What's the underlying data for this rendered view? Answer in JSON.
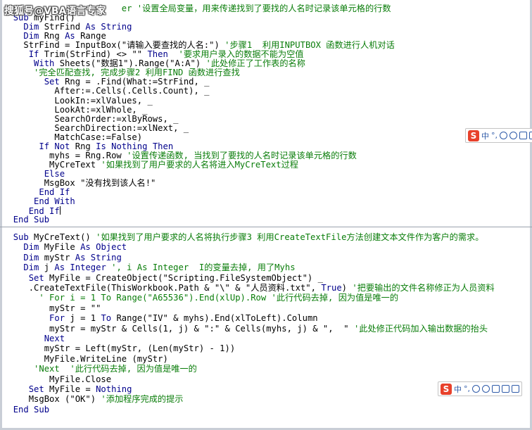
{
  "watermark": "搜狐号@VBA语言专家",
  "top_code": [
    {
      "indent": "   ",
      "parts": [
        {
          "t": "er '设置全局变量，用来传递找到了要找的人名时记录该单元格的行数",
          "c": "cm"
        }
      ],
      "lead": "Public myhs As Integ"
    },
    {
      "indent": "  ",
      "parts": [
        {
          "t": "Sub ",
          "c": "kw"
        },
        {
          "t": "myFind()",
          "c": ""
        }
      ]
    },
    {
      "indent": "    ",
      "parts": [
        {
          "t": "Dim ",
          "c": "kw"
        },
        {
          "t": "StrFind ",
          "c": ""
        },
        {
          "t": "As String",
          "c": "kw"
        }
      ]
    },
    {
      "indent": "    ",
      "parts": [
        {
          "t": "Dim ",
          "c": "kw"
        },
        {
          "t": "Rng ",
          "c": ""
        },
        {
          "t": "As ",
          "c": "kw"
        },
        {
          "t": "Range",
          "c": ""
        }
      ]
    },
    {
      "indent": "    ",
      "parts": [
        {
          "t": "StrFind = InputBox(\"请输入要查找的人名:\") ",
          "c": ""
        },
        {
          "t": "'步骤1  利用INPUTBOX 函数进行人机对话",
          "c": "cm"
        }
      ]
    },
    {
      "indent": "     ",
      "parts": [
        {
          "t": "If ",
          "c": "kw"
        },
        {
          "t": "Trim(StrFind) <> \"\" ",
          "c": ""
        },
        {
          "t": "Then  ",
          "c": "kw"
        },
        {
          "t": "'要求用户录入的数据不能为空值",
          "c": "cm"
        }
      ]
    },
    {
      "indent": "      ",
      "parts": [
        {
          "t": "With ",
          "c": "kw"
        },
        {
          "t": "Sheets(\"数据1\").Range(\"A:A\") ",
          "c": ""
        },
        {
          "t": "'此处修正了工作表的名称",
          "c": "cm"
        }
      ]
    },
    {
      "indent": "      ",
      "parts": [
        {
          "t": "'完全匹配查找, 完成步骤2 利用FIND 函数进行查找",
          "c": "cm"
        }
      ]
    },
    {
      "indent": "        ",
      "parts": [
        {
          "t": "Set ",
          "c": "kw"
        },
        {
          "t": "Rng = .Find(What:=StrFind, _",
          "c": ""
        }
      ]
    },
    {
      "indent": "          ",
      "parts": [
        {
          "t": "After:=.Cells(.Cells.Count), _",
          "c": ""
        }
      ]
    },
    {
      "indent": "          ",
      "parts": [
        {
          "t": "LookIn:=xlValues, _",
          "c": ""
        }
      ]
    },
    {
      "indent": "          ",
      "parts": [
        {
          "t": "LookAt:=xlWhole, _",
          "c": ""
        }
      ]
    },
    {
      "indent": "          ",
      "parts": [
        {
          "t": "SearchOrder:=xlByRows, _",
          "c": ""
        }
      ]
    },
    {
      "indent": "          ",
      "parts": [
        {
          "t": "SearchDirection:=xlNext, _",
          "c": ""
        }
      ]
    },
    {
      "indent": "          ",
      "parts": [
        {
          "t": "MatchCase:=False)",
          "c": ""
        }
      ]
    },
    {
      "indent": "       ",
      "parts": [
        {
          "t": "If Not ",
          "c": "kw"
        },
        {
          "t": "Rng ",
          "c": ""
        },
        {
          "t": "Is Nothing Then",
          "c": "kw"
        }
      ]
    },
    {
      "indent": "         ",
      "parts": [
        {
          "t": "myhs = Rng.Row ",
          "c": ""
        },
        {
          "t": "'设置传递函数, 当找到了要找的人名时记录该单元格的行数",
          "c": "cm"
        }
      ]
    },
    {
      "indent": "         ",
      "parts": [
        {
          "t": "MyCreText ",
          "c": ""
        },
        {
          "t": "'如果找到了用户要求的人名将进入MyCreText过程",
          "c": "cm"
        }
      ]
    },
    {
      "indent": "        ",
      "parts": [
        {
          "t": "Else",
          "c": "kw"
        }
      ]
    },
    {
      "indent": "        ",
      "parts": [
        {
          "t": "MsgBox \"没有找到该人名!\"",
          "c": ""
        }
      ]
    },
    {
      "indent": "       ",
      "parts": [
        {
          "t": "End If",
          "c": "kw"
        }
      ]
    },
    {
      "indent": "      ",
      "parts": [
        {
          "t": "End With",
          "c": "kw"
        }
      ]
    },
    {
      "indent": "     ",
      "parts": [
        {
          "t": "End If",
          "c": "kw"
        }
      ],
      "cursor": true
    },
    {
      "indent": "  ",
      "parts": [
        {
          "t": "End Sub",
          "c": "kw"
        }
      ]
    }
  ],
  "bottom_code": [
    {
      "indent": "  ",
      "parts": [
        {
          "t": "Sub ",
          "c": "kw"
        },
        {
          "t": "MyCreText() ",
          "c": ""
        },
        {
          "t": "'如果找到了用户要求的人名将执行步骤3 利用CreateTextFile方法创建文本文件作为客户的需求。",
          "c": "cm"
        }
      ]
    },
    {
      "indent": "    ",
      "parts": [
        {
          "t": "Dim ",
          "c": "kw"
        },
        {
          "t": "MyFile ",
          "c": ""
        },
        {
          "t": "As Object",
          "c": "kw"
        }
      ]
    },
    {
      "indent": "    ",
      "parts": [
        {
          "t": "Dim ",
          "c": "kw"
        },
        {
          "t": "myStr ",
          "c": ""
        },
        {
          "t": "As String",
          "c": "kw"
        }
      ]
    },
    {
      "indent": "    ",
      "parts": [
        {
          "t": "Dim ",
          "c": "kw"
        },
        {
          "t": "j ",
          "c": ""
        },
        {
          "t": "As Integer ",
          "c": "kw"
        },
        {
          "t": "', i As Integer  I的变量去掉, 用了Myhs",
          "c": "cm"
        }
      ]
    },
    {
      "indent": "     ",
      "parts": [
        {
          "t": "Set ",
          "c": "kw"
        },
        {
          "t": "MyFile = CreateObject(\"Scripting.FileSystemObject\") _",
          "c": ""
        }
      ]
    },
    {
      "indent": "     ",
      "parts": [
        {
          "t": ".CreateTextFile(ThisWorkbook.Path & \"\\\" & \"人员资料.txt\", ",
          "c": ""
        },
        {
          "t": "True",
          "c": "kw"
        },
        {
          "t": ") ",
          "c": ""
        },
        {
          "t": "'把要输出的文件名称修正为人员资料",
          "c": "cm"
        }
      ]
    },
    {
      "indent": "       ",
      "parts": [
        {
          "t": "' For i = 1 To Range(\"A65536\").End(xlUp).Row '此行代码去掉, 因为值是唯一的",
          "c": "cm"
        }
      ]
    },
    {
      "indent": "         ",
      "parts": [
        {
          "t": "myStr = \"\"",
          "c": ""
        }
      ]
    },
    {
      "indent": "         ",
      "parts": [
        {
          "t": "For ",
          "c": "kw"
        },
        {
          "t": "j = 1 ",
          "c": ""
        },
        {
          "t": "To ",
          "c": "kw"
        },
        {
          "t": "Range(\"IV\" & myhs).End(xlToLeft).Column",
          "c": ""
        }
      ]
    },
    {
      "indent": "         ",
      "parts": [
        {
          "t": "myStr = myStr & Cells(1, j) & \":\" & Cells(myhs, j) & \",  \" ",
          "c": ""
        },
        {
          "t": "'此处修正代码加入输出数据的抬头",
          "c": "cm"
        }
      ]
    },
    {
      "indent": "        ",
      "parts": [
        {
          "t": "Next",
          "c": "kw"
        }
      ]
    },
    {
      "indent": "        ",
      "parts": [
        {
          "t": "myStr = Left(myStr, (Len(myStr) - 1))",
          "c": ""
        }
      ]
    },
    {
      "indent": "        ",
      "parts": [
        {
          "t": "MyFile.WriteLine (myStr)",
          "c": ""
        }
      ]
    },
    {
      "indent": "      ",
      "parts": [
        {
          "t": "'Next  '此行代码去掉, 因为值是唯一的",
          "c": "cm"
        }
      ]
    },
    {
      "indent": "         ",
      "parts": [
        {
          "t": "MyFile.Close",
          "c": ""
        }
      ]
    },
    {
      "indent": "     ",
      "parts": [
        {
          "t": "Set ",
          "c": "kw"
        },
        {
          "t": "MyFile = ",
          "c": ""
        },
        {
          "t": "Nothing",
          "c": "kw"
        }
      ]
    },
    {
      "indent": "     ",
      "parts": [
        {
          "t": "MsgBox (\"OK\") ",
          "c": ""
        },
        {
          "t": "'添加程序完成的提示",
          "c": "cm"
        }
      ]
    },
    {
      "indent": "  ",
      "parts": [
        {
          "t": "End Sub",
          "c": "kw"
        }
      ]
    }
  ],
  "ime_bar": {
    "logo": "S",
    "mode": "中",
    "punct": "°,",
    "icons": [
      "emoji-icon",
      "mic-icon",
      "keyboard-icon",
      "skin-icon",
      "toolbox-icon"
    ]
  },
  "colors": {
    "keyword": "#00008b",
    "comment": "#0a7d0a",
    "text": "#000000"
  }
}
